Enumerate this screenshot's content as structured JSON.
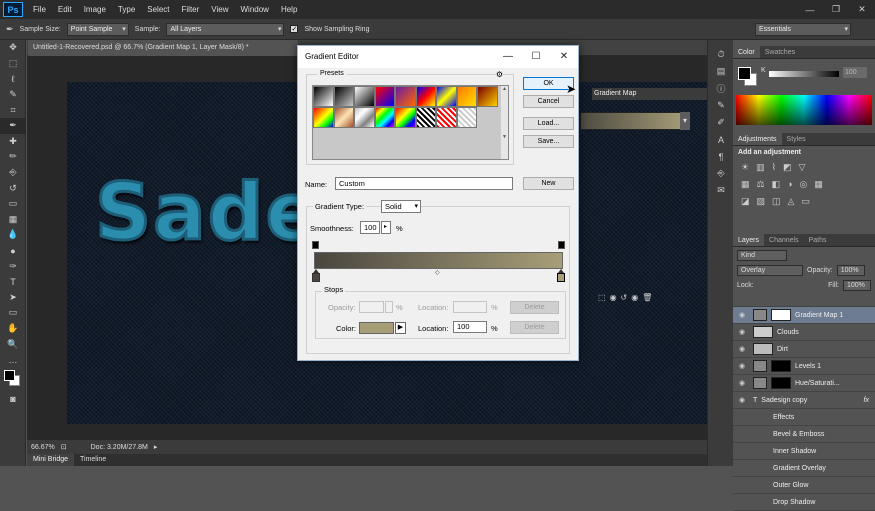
{
  "menubar": {
    "logo": "Ps",
    "items": [
      "File",
      "Edit",
      "Image",
      "Type",
      "Select",
      "Filter",
      "View",
      "Window",
      "Help"
    ],
    "controls": [
      "—",
      "❐",
      "✕"
    ]
  },
  "options": {
    "sample_size_label": "Sample Size:",
    "sample_size_value": "Point Sample",
    "sample_label": "Sample:",
    "sample_value": "All Layers",
    "show_ring_label": "Show Sampling Ring",
    "workspace": "Essentials"
  },
  "document": {
    "tab": "Untitled-1-Recovered.psd @ 66.7% (Gradient Map 1, Layer Mask/8) *",
    "art_text": "Sadesign",
    "zoom": "66.67%",
    "doc_size": "Doc: 3.20M/27.8M"
  },
  "bottom_tabs": [
    "Mini Bridge",
    "Timeline"
  ],
  "behind_dialog": {
    "properties_title": "Gradient Map"
  },
  "dialog": {
    "title": "Gradient Editor",
    "ok": "OK",
    "cancel": "Cancel",
    "load": "Load...",
    "save": "Save...",
    "presets_label": "Presets",
    "name_label": "Name:",
    "name_value": "Custom",
    "new_button": "New",
    "gradient_type_label": "Gradient Type:",
    "gradient_type_value": "Solid",
    "smoothness_label": "Smoothness:",
    "smoothness_value": "100",
    "percent": "%",
    "stops_label": "Stops",
    "opacity_label": "Opacity:",
    "location_label": "Location:",
    "delete_label": "Delete",
    "color_label": "Color:",
    "color_location_value": "100",
    "gradient_start": "#4a463f",
    "gradient_end": "#a79e78",
    "presets": [
      "linear-gradient(135deg,#000,#fff)",
      "linear-gradient(135deg,#000,rgba(0,0,0,0))",
      "linear-gradient(135deg,#fff,#000)",
      "linear-gradient(135deg,#ff0000,#00f)",
      "linear-gradient(135deg,#6a1ba4,#ff6600)",
      "linear-gradient(135deg,#0000ff,#ff0000,#ffff00)",
      "linear-gradient(135deg,#0000ff,#ffff00,#0000ff)",
      "linear-gradient(135deg,#ff7a00,#ffe000)",
      "linear-gradient(135deg,#7a0000,#ffd000)",
      "linear-gradient(135deg,#ff0000,#ff8000,#ffff00,#00ff00,#0000ff)",
      "linear-gradient(135deg,#a0522d,#ffe4b5,#a0522d)",
      "linear-gradient(135deg,#c0c0c0,#fff,#808080,#fff)",
      "linear-gradient(135deg,#ff0000,#ffff00,#00ff00,#00ffff,#0000ff,#ff00ff)",
      "linear-gradient(135deg,#ff0000,#ff8000,#ffff00,#00ff00,#0000ff,#8000ff)",
      "repeating-linear-gradient(45deg,#000 0 2px,#fff 2px 4px)",
      "repeating-linear-gradient(45deg,#ff0000 0 2px,#fff 2px 4px)",
      "repeating-linear-gradient(45deg,#ccc 0 2px,#fff 2px 4px)"
    ]
  },
  "panels": {
    "color_tabs": [
      "Color",
      "Swatches"
    ],
    "k_label": "K",
    "k_value": "100",
    "adj_tabs": [
      "Adjustments",
      "Styles"
    ],
    "adj_title": "Add an adjustment",
    "layer_tabs": [
      "Layers",
      "Channels",
      "Paths"
    ],
    "kind": "Kind",
    "blend": "Overlay",
    "opacity_label": "Opacity:",
    "opacity_value": "100%",
    "lock_label": "Lock:",
    "fill_label": "Fill:",
    "fill_value": "100%",
    "layers": [
      "Gradient Map 1",
      "Clouds",
      "Dirt",
      "Levels 1",
      "Hue/Saturati...",
      "Sadesign copy"
    ],
    "effects": [
      "Effects",
      "Bevel & Emboss",
      "Inner Shadow",
      "Gradient Overlay",
      "Outer Glow",
      "Drop Shadow"
    ]
  }
}
